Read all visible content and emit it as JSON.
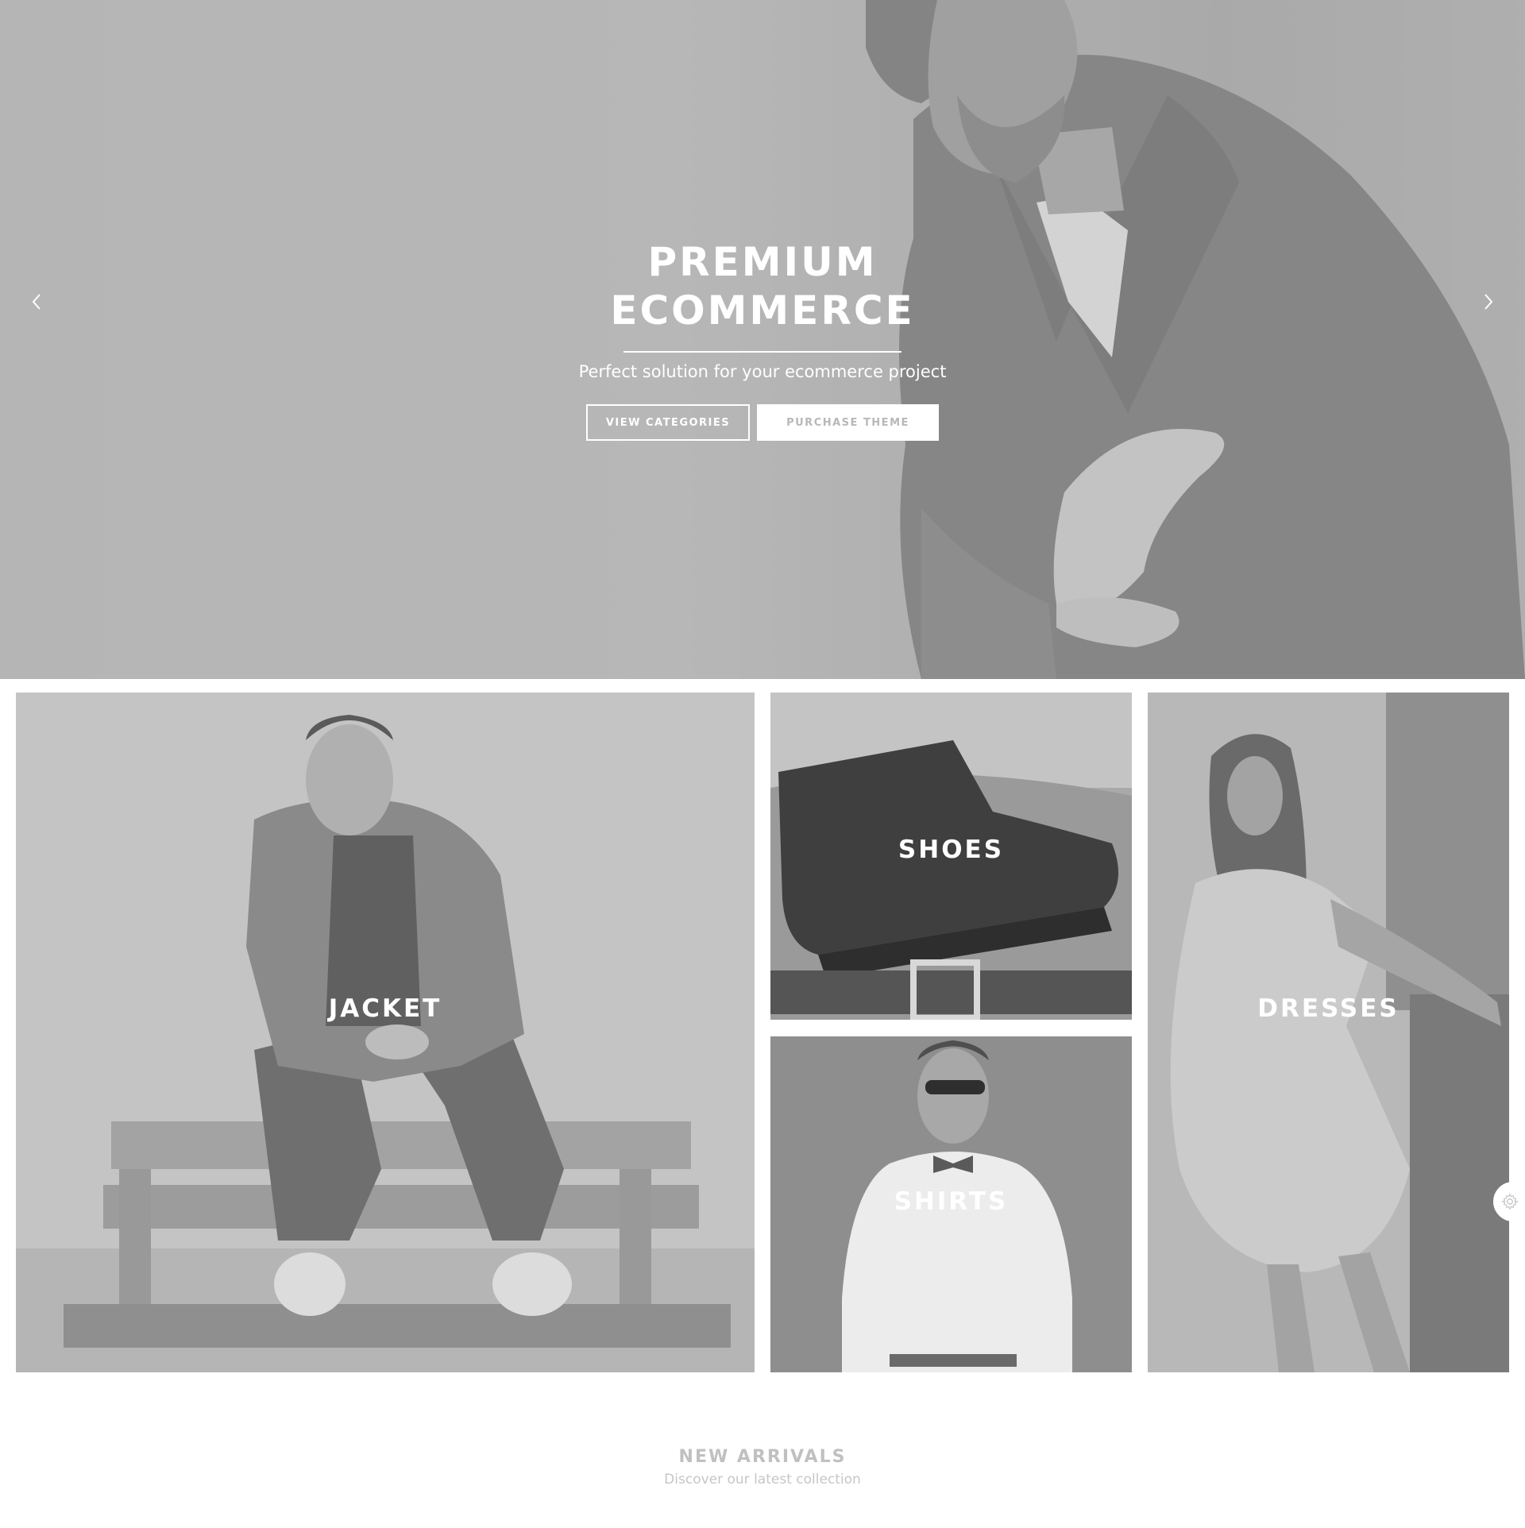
{
  "hero": {
    "title_line1": "PREMIUM",
    "title_line2": "ECOMMERCE",
    "subtitle": "Perfect solution for your ecommerce project",
    "primary_button": "VIEW CATEGORIES",
    "secondary_button": "PURCHASE THEME",
    "prev_icon": "chevron-left-icon",
    "next_icon": "chevron-right-icon"
  },
  "categories": [
    {
      "label": "JACKET"
    },
    {
      "label": "SHOES"
    },
    {
      "label": "SHIRTS"
    },
    {
      "label": "DRESSES"
    }
  ],
  "settings": {
    "icon": "gear-icon"
  },
  "new_arrivals": {
    "title": "NEW ARRIVALS",
    "subtitle": "Discover our latest collection"
  },
  "colors": {
    "overlay_grey": "#b5b5b5",
    "text_white": "#ffffff",
    "muted_heading": "#c0c0c0"
  }
}
